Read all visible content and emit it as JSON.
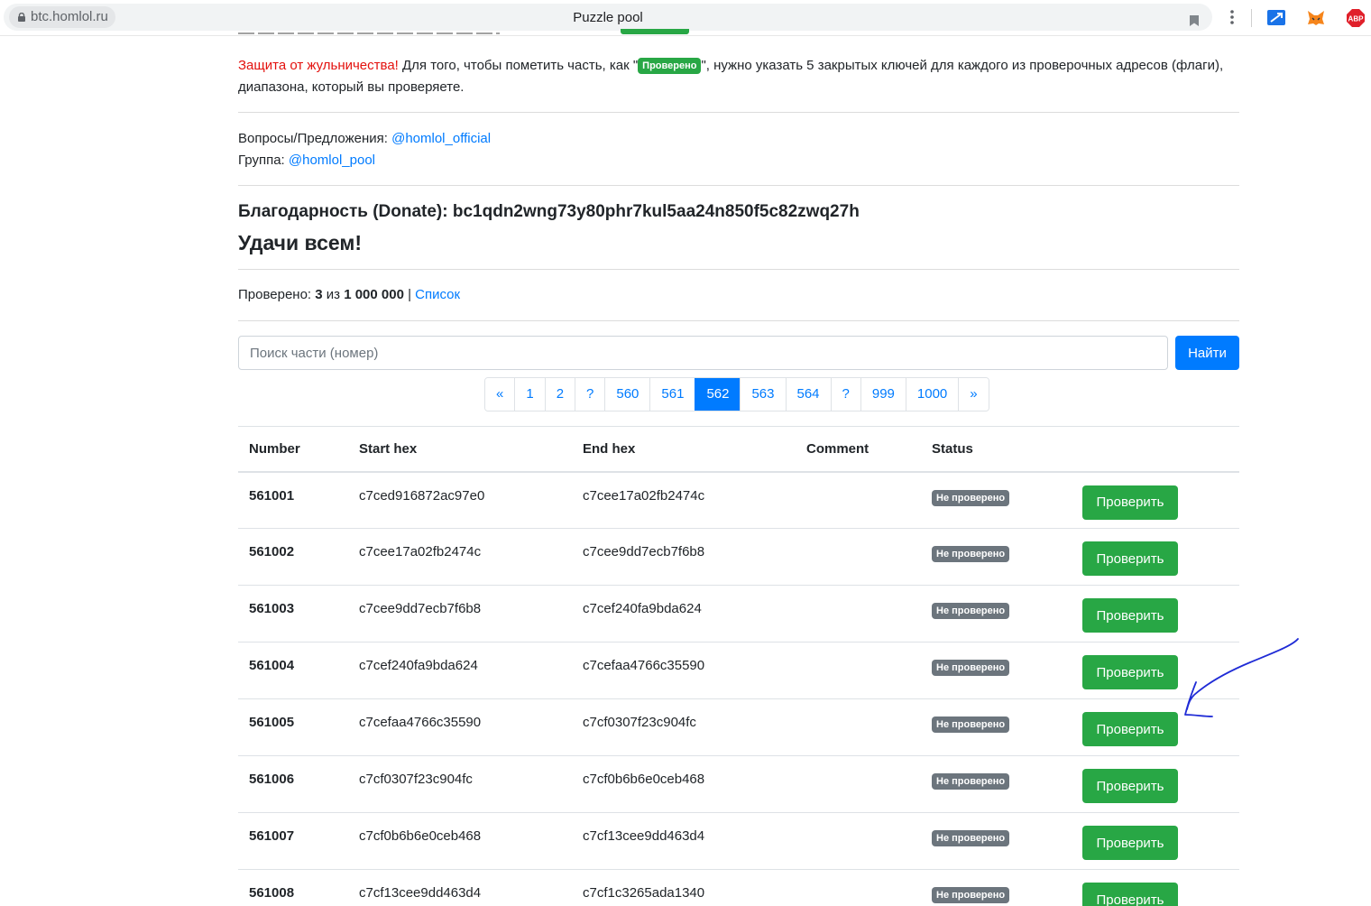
{
  "browser": {
    "url": "btc.homlol.ru",
    "tab_title": "Puzzle pool",
    "accent_color": "#1a73e8"
  },
  "notice": {
    "warning": "Защита от жульничества!",
    "text_before_badge": " Для того, чтобы пометить часть, как \"",
    "badge": "Проверено",
    "text_after_badge": "\", нужно указать 5 закрытых ключей для каждого из проверочных адресов (флаги), диапазона, который вы проверяете."
  },
  "contacts": {
    "questions_label": "Вопросы/Предложения: ",
    "questions_link": "@homlol_official",
    "group_label": "Группа: ",
    "group_link": "@homlol_pool"
  },
  "donate": {
    "label": "Благодарность (Donate): bc1qdn2wng73y80phr7kul5aa24n850f5c82zwq27h"
  },
  "greeting": "Удачи всем!",
  "progress": {
    "label": "Проверено: ",
    "checked": "3",
    "of": " из ",
    "total": "1 000 000",
    "separator": " | ",
    "list_link": "Список"
  },
  "search": {
    "placeholder": "Поиск части (номер)",
    "button": "Найти"
  },
  "pagination": [
    "«",
    "1",
    "2",
    "?",
    "560",
    "561",
    "562",
    "563",
    "564",
    "?",
    "999",
    "1000",
    "»"
  ],
  "pagination_active": "562",
  "table": {
    "columns": [
      "Number",
      "Start hex",
      "End hex",
      "Comment",
      "Status"
    ],
    "status_label": "Не проверено",
    "action_label": "Проверить",
    "rows": [
      {
        "number": "561001",
        "start": "c7ced916872ac97e0",
        "end": "c7cee17a02fb2474c"
      },
      {
        "number": "561002",
        "start": "c7cee17a02fb2474c",
        "end": "c7cee9dd7ecb7f6b8"
      },
      {
        "number": "561003",
        "start": "c7cee9dd7ecb7f6b8",
        "end": "c7cef240fa9bda624"
      },
      {
        "number": "561004",
        "start": "c7cef240fa9bda624",
        "end": "c7cefaa4766c35590"
      },
      {
        "number": "561005",
        "start": "c7cefaa4766c35590",
        "end": "c7cf0307f23c904fc"
      },
      {
        "number": "561006",
        "start": "c7cf0307f23c904fc",
        "end": "c7cf0b6b6e0ceb468"
      },
      {
        "number": "561007",
        "start": "c7cf0b6b6e0ceb468",
        "end": "c7cf13cee9dd463d4"
      },
      {
        "number": "561008",
        "start": "c7cf13cee9dd463d4",
        "end": "c7cf1c3265ada1340"
      }
    ]
  },
  "colors": {
    "primary": "#007bff",
    "success": "#28a745",
    "secondary": "#6c757d",
    "danger": "#e3110e",
    "annotation_arrow": "#1f2bd6"
  }
}
